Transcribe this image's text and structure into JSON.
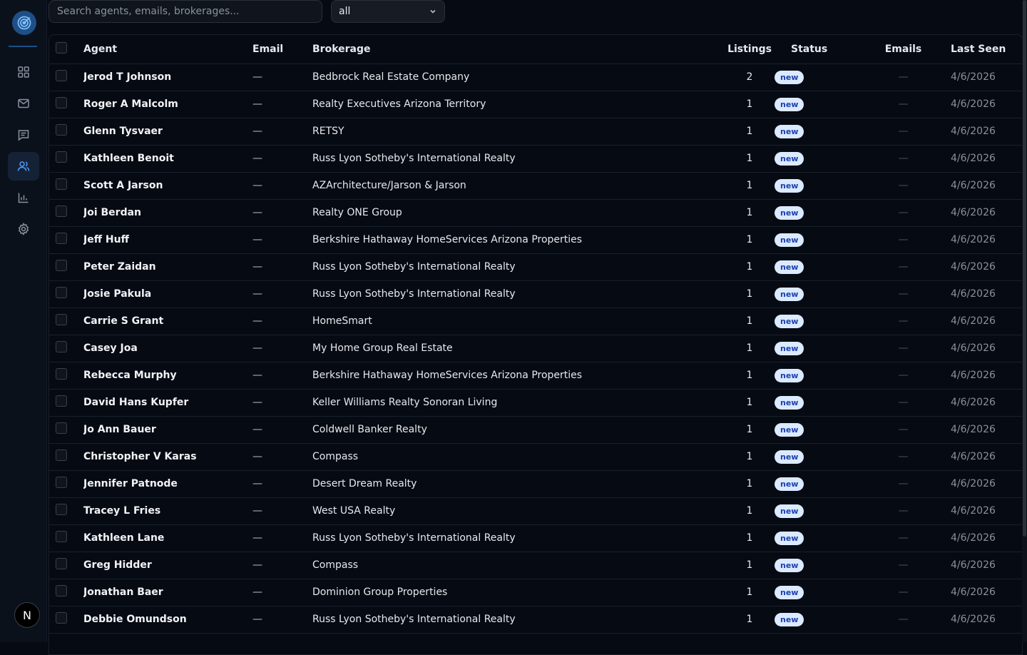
{
  "search": {
    "placeholder": "Search agents, emails, brokerages..."
  },
  "filter": {
    "selected": "all"
  },
  "avatar": {
    "initial": "N"
  },
  "columns": {
    "agent": "Agent",
    "email": "Email",
    "brokerage": "Brokerage",
    "listings": "Listings",
    "status": "Status",
    "emails": "Emails",
    "last_seen": "Last Seen"
  },
  "rows": [
    {
      "agent": "Jerod T Johnson",
      "email": "—",
      "brokerage": "Bedbrock Real Estate Company",
      "listings": "2",
      "status": "new",
      "emails": "—",
      "last_seen": "4/6/2026"
    },
    {
      "agent": "Roger A Malcolm",
      "email": "—",
      "brokerage": "Realty Executives Arizona Territory",
      "listings": "1",
      "status": "new",
      "emails": "—",
      "last_seen": "4/6/2026"
    },
    {
      "agent": "Glenn Tysvaer",
      "email": "—",
      "brokerage": "RETSY",
      "listings": "1",
      "status": "new",
      "emails": "—",
      "last_seen": "4/6/2026"
    },
    {
      "agent": "Kathleen Benoit",
      "email": "—",
      "brokerage": "Russ Lyon Sotheby's International Realty",
      "listings": "1",
      "status": "new",
      "emails": "—",
      "last_seen": "4/6/2026"
    },
    {
      "agent": "Scott A Jarson",
      "email": "—",
      "brokerage": "AZArchitecture/Jarson & Jarson",
      "listings": "1",
      "status": "new",
      "emails": "—",
      "last_seen": "4/6/2026"
    },
    {
      "agent": "Joi Berdan",
      "email": "—",
      "brokerage": "Realty ONE Group",
      "listings": "1",
      "status": "new",
      "emails": "—",
      "last_seen": "4/6/2026"
    },
    {
      "agent": "Jeff Huff",
      "email": "—",
      "brokerage": "Berkshire Hathaway HomeServices Arizona Properties",
      "listings": "1",
      "status": "new",
      "emails": "—",
      "last_seen": "4/6/2026"
    },
    {
      "agent": "Peter Zaidan",
      "email": "—",
      "brokerage": "Russ Lyon Sotheby's International Realty",
      "listings": "1",
      "status": "new",
      "emails": "—",
      "last_seen": "4/6/2026"
    },
    {
      "agent": "Josie Pakula",
      "email": "—",
      "brokerage": "Russ Lyon Sotheby's International Realty",
      "listings": "1",
      "status": "new",
      "emails": "—",
      "last_seen": "4/6/2026"
    },
    {
      "agent": "Carrie S Grant",
      "email": "—",
      "brokerage": "HomeSmart",
      "listings": "1",
      "status": "new",
      "emails": "—",
      "last_seen": "4/6/2026"
    },
    {
      "agent": "Casey Joa",
      "email": "—",
      "brokerage": "My Home Group Real Estate",
      "listings": "1",
      "status": "new",
      "emails": "—",
      "last_seen": "4/6/2026"
    },
    {
      "agent": "Rebecca Murphy",
      "email": "—",
      "brokerage": "Berkshire Hathaway HomeServices Arizona Properties",
      "listings": "1",
      "status": "new",
      "emails": "—",
      "last_seen": "4/6/2026"
    },
    {
      "agent": "David Hans Kupfer",
      "email": "—",
      "brokerage": "Keller Williams Realty Sonoran Living",
      "listings": "1",
      "status": "new",
      "emails": "—",
      "last_seen": "4/6/2026"
    },
    {
      "agent": "Jo Ann Bauer",
      "email": "—",
      "brokerage": "Coldwell Banker Realty",
      "listings": "1",
      "status": "new",
      "emails": "—",
      "last_seen": "4/6/2026"
    },
    {
      "agent": "Christopher V Karas",
      "email": "—",
      "brokerage": "Compass",
      "listings": "1",
      "status": "new",
      "emails": "—",
      "last_seen": "4/6/2026"
    },
    {
      "agent": "Jennifer Patnode",
      "email": "—",
      "brokerage": "Desert Dream Realty",
      "listings": "1",
      "status": "new",
      "emails": "—",
      "last_seen": "4/6/2026"
    },
    {
      "agent": "Tracey L Fries",
      "email": "—",
      "brokerage": "West USA Realty",
      "listings": "1",
      "status": "new",
      "emails": "—",
      "last_seen": "4/6/2026"
    },
    {
      "agent": "Kathleen Lane",
      "email": "—",
      "brokerage": "Russ Lyon Sotheby's International Realty",
      "listings": "1",
      "status": "new",
      "emails": "—",
      "last_seen": "4/6/2026"
    },
    {
      "agent": "Greg Hidder",
      "email": "—",
      "brokerage": "Compass",
      "listings": "1",
      "status": "new",
      "emails": "—",
      "last_seen": "4/6/2026"
    },
    {
      "agent": "Jonathan Baer",
      "email": "—",
      "brokerage": "Dominion Group Properties",
      "listings": "1",
      "status": "new",
      "emails": "—",
      "last_seen": "4/6/2026"
    },
    {
      "agent": "Debbie Omundson",
      "email": "—",
      "brokerage": "Russ Lyon Sotheby's International Realty",
      "listings": "1",
      "status": "new",
      "emails": "—",
      "last_seen": "4/6/2026"
    }
  ]
}
